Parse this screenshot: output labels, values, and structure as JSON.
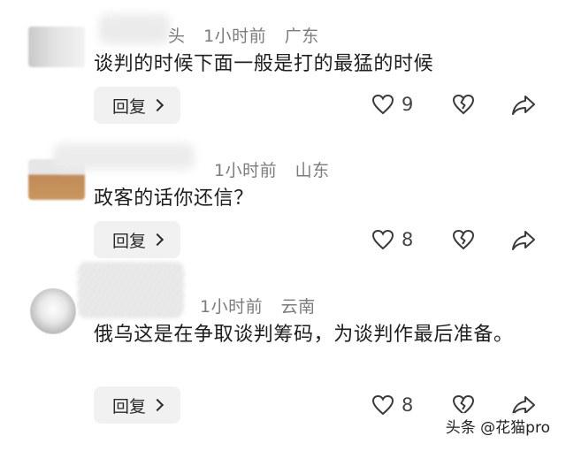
{
  "reply_label": "回复",
  "comments": [
    {
      "meta": {
        "name_suffix": "头",
        "time": "1小时前",
        "location": "广东"
      },
      "text": "谈判的时候下面一般是打的最猛的时候",
      "likes": "9"
    },
    {
      "meta": {
        "name_suffix": "",
        "time": "1小时前",
        "location": "山东"
      },
      "text": "政客的话你还信？",
      "likes": "8"
    },
    {
      "meta": {
        "name_suffix": "",
        "time": "1小时前",
        "location": "云南"
      },
      "text": "俄乌这是在争取谈判筹码，为谈判作最后准备。",
      "likes": "8"
    }
  ],
  "icons": [
    "heart-icon",
    "broken-heart-icon",
    "share-arrow-icon",
    "chevron-right-icon"
  ],
  "watermark": "头条 @花猫pro"
}
